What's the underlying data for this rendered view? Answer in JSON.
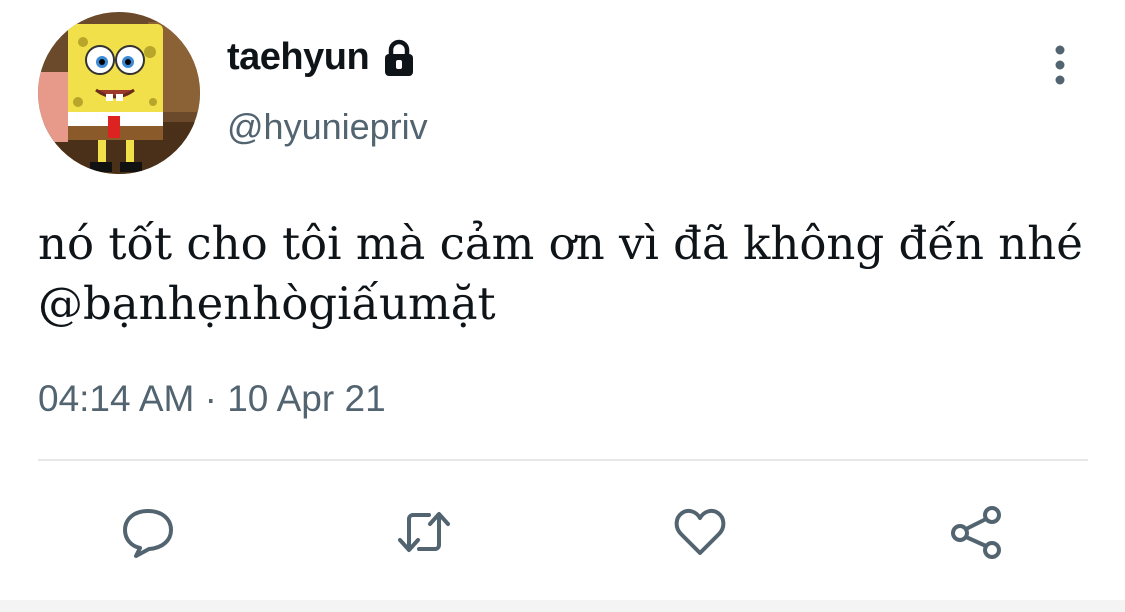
{
  "tweet": {
    "author": {
      "display_name": "taehyun",
      "handle": "@hyuniepriv",
      "avatar_icon": "spongebob-avatar",
      "protected_icon": "lock-icon"
    },
    "text": "nó tốt cho tôi mà cảm ơn vì đã không đến nhé @bạnhẹnhògiấumặt",
    "time": "04:14 AM",
    "separator": "·",
    "date": "10 Apr 21"
  },
  "actions": [
    {
      "name": "reply",
      "icon": "speech-bubble-icon"
    },
    {
      "name": "retweet",
      "icon": "retweet-arrows-icon"
    },
    {
      "name": "like",
      "icon": "heart-icon"
    },
    {
      "name": "share",
      "icon": "share-nodes-icon"
    }
  ],
  "colors": {
    "text": "#0f1419",
    "secondary": "#536471",
    "divider": "#e7e7e7"
  }
}
